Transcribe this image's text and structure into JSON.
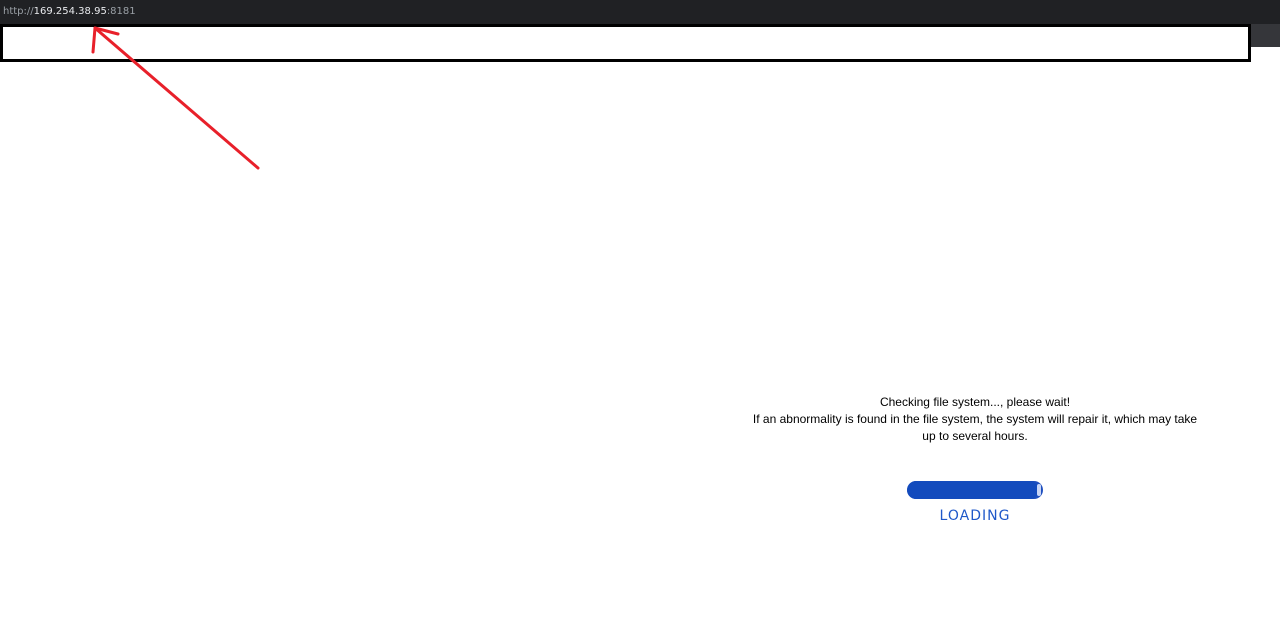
{
  "browser": {
    "url_scheme": "http://",
    "url_host": "169.254.38.95",
    "url_port": ":8181"
  },
  "status": {
    "line1": "Checking file system..., please wait!",
    "line2": "If an abnormality is found in the file system, the system will repair it, which may take up to several hours."
  },
  "loader": {
    "label": "LOADING",
    "progress": 0.97
  },
  "colors": {
    "address_bar": "#202124",
    "progress_bar": "#134bbd",
    "loading_text": "#1f58c9",
    "annotation_arrow": "#e8202a"
  }
}
